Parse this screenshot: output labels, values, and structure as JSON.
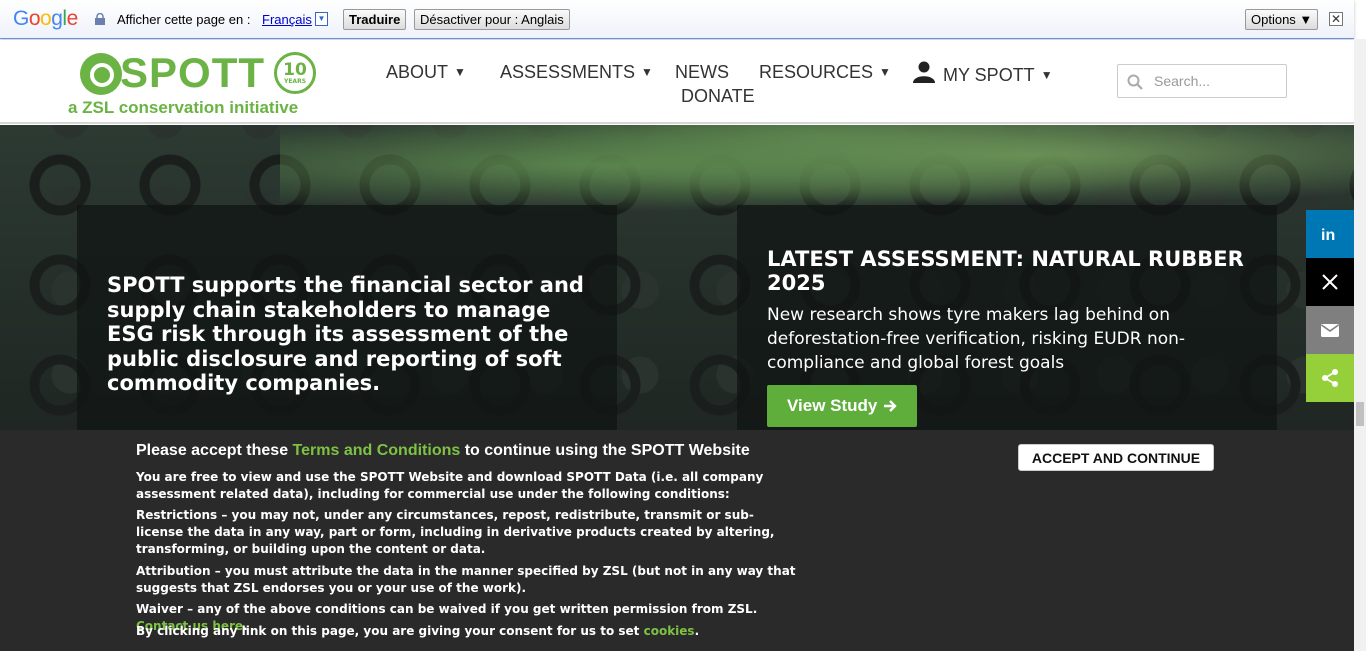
{
  "translate_bar": {
    "logo": "Google",
    "prompt": "Afficher cette page en :",
    "language": "Français",
    "translate_button": "Traduire",
    "disable_button": "Désactiver pour : Anglais",
    "options_button": "Options ▼",
    "close": "✕"
  },
  "header": {
    "logo_text": "SPOTT",
    "logo_badge_number": "10",
    "logo_badge_label": "YEARS",
    "tagline": "a ZSL conservation initiative",
    "nav": {
      "about": "ABOUT",
      "assessments": "ASSESSMENTS",
      "news": "NEWS",
      "resources": "RESOURCES",
      "my_spott": "MY SPOTT",
      "donate": "DONATE",
      "caret": "▼"
    },
    "search_placeholder": "Search..."
  },
  "hero": {
    "left_text": "SPOTT supports the financial sector and supply chain stakeholders to manage ESG risk through its assessment of the public disclosure and reporting of soft commodity companies.",
    "latest_title": "LATEST ASSESSMENT: NATURAL RUBBER 2025",
    "latest_desc": "New research shows tyre makers lag behind on deforestation-free verification, risking EUDR non-compliance and global forest goals",
    "view_button": "View Study"
  },
  "share": [
    {
      "name": "linkedin",
      "color": "#0077b5"
    },
    {
      "name": "x",
      "color": "#000000"
    },
    {
      "name": "email",
      "color": "#7f7f7f"
    },
    {
      "name": "share",
      "color": "#95d03a"
    }
  ],
  "cookie": {
    "head_pre": "Please accept these ",
    "head_link": "Terms and Conditions",
    "head_post": " to continue using the SPOTT Website",
    "p1": "You are free to view and use the SPOTT Website and download SPOTT Data (i.e. all company assessment related data), including for commercial use under the following conditions:",
    "p2": "Restrictions – you may not, under any circumstances, repost, redistribute, transmit or sub-license the data in any way, part or form, including in derivative products created by altering, transforming, or building upon the content or data.",
    "p3": "Attribution – you must attribute the data in the manner specified by ZSL (but not in any way that suggests that ZSL endorses you or your use of the work).",
    "p4_pre": "Waiver – any of the above conditions can be waived if you get written permission from ZSL. ",
    "p4_link": "Contact us here",
    "p4_post": ".",
    "p5_pre": "By clicking any link on this page, you are giving your consent for us to set ",
    "p5_link": "cookies",
    "p5_post": ".",
    "accept_button": "ACCEPT AND CONTINUE"
  }
}
